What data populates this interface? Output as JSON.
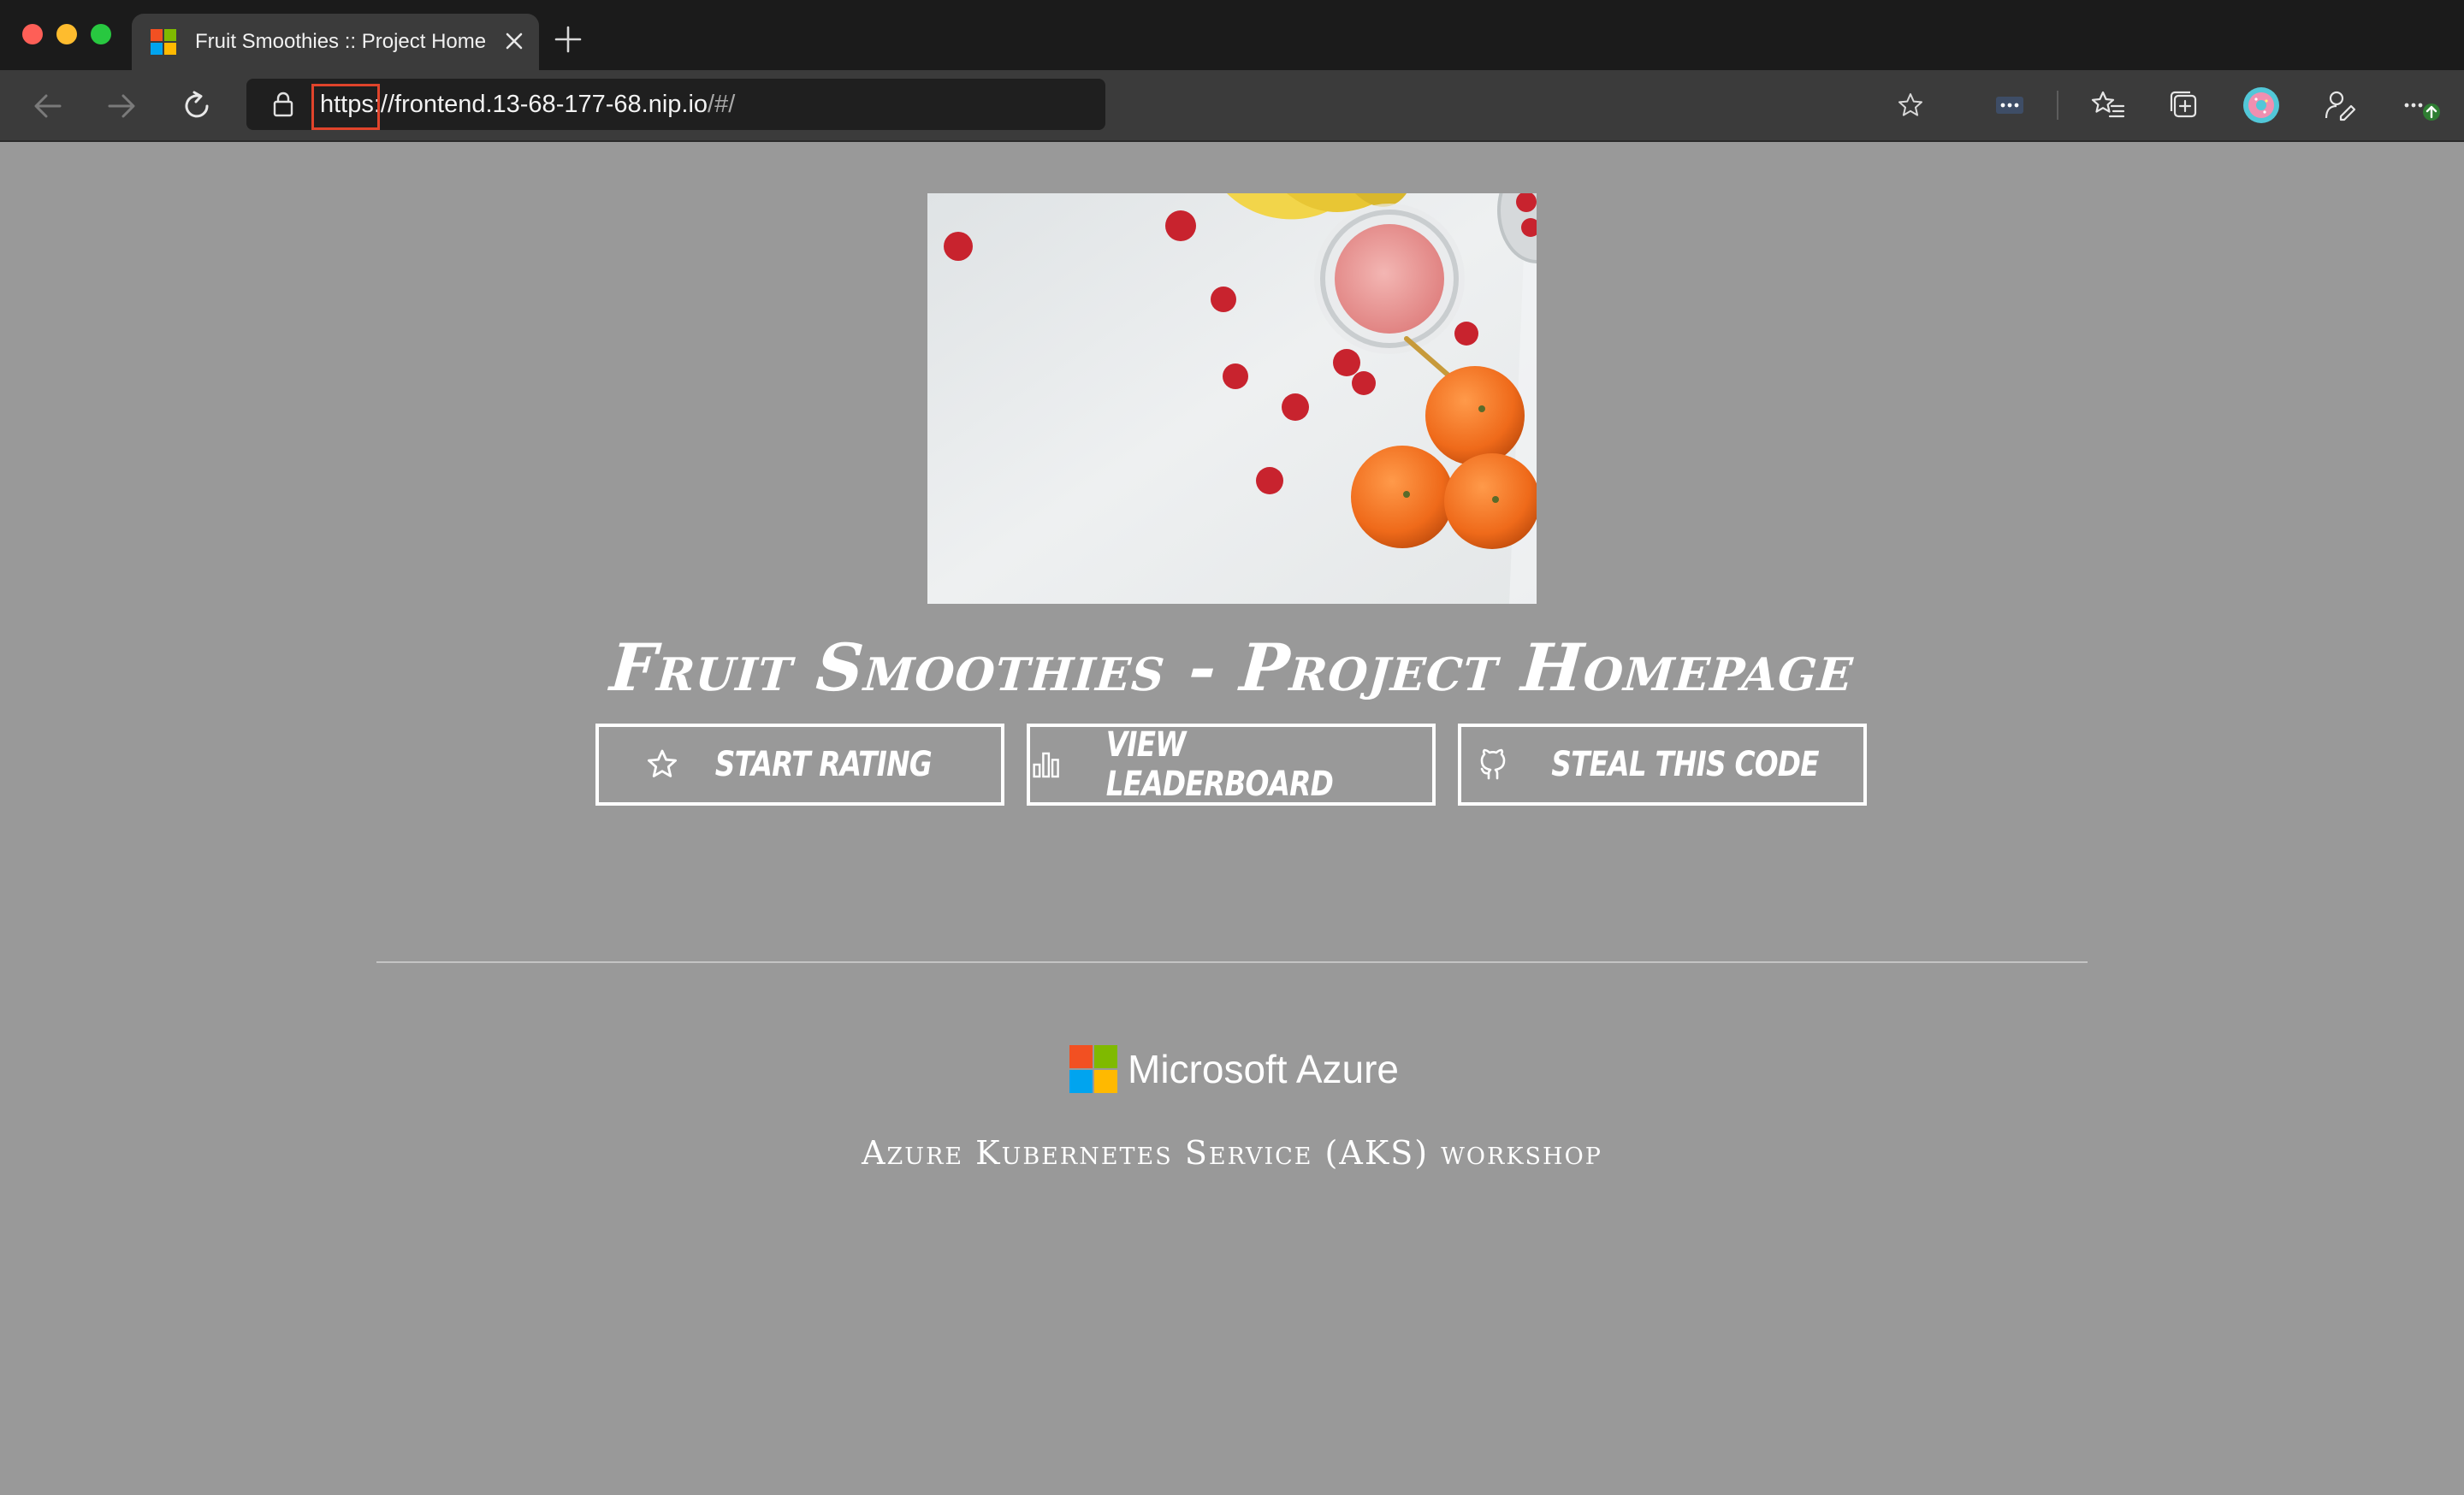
{
  "browser": {
    "tab": {
      "title": "Fruit Smoothies :: Project Homepage"
    },
    "address_bar": {
      "url_protocol": "https",
      "url_rest": "://frontend.13-68-177-68.nip.io",
      "url_path": "/#/"
    },
    "icons": {
      "back": "arrow-left-icon",
      "forward": "arrow-right-icon",
      "reload": "reload-icon",
      "lock": "lock-icon",
      "favorite": "star-icon",
      "extension": "extension-icon",
      "favorites": "favorites-icon",
      "collections": "collections-icon",
      "profile": "avatar-icon",
      "feedback": "feedback-icon",
      "more": "ellipsis-icon"
    }
  },
  "page": {
    "title": "Fruit Smoothies - Project Homepage",
    "buttons": [
      {
        "label": "Start Rating",
        "icon": "star-icon"
      },
      {
        "label": "View Leaderboard",
        "icon": "bar-chart-icon"
      },
      {
        "label": "Steal This Code",
        "icon": "github-icon"
      }
    ],
    "footer": {
      "brand": "Microsoft Azure",
      "subtitle": "Azure Kubernetes Service (AKS) workshop"
    }
  },
  "colors": {
    "page_background": "#999999",
    "highlight_box": "#e0442b",
    "ms_red": "#f25022",
    "ms_green": "#7fba00",
    "ms_blue": "#00a4ef",
    "ms_yellow": "#ffb900"
  }
}
